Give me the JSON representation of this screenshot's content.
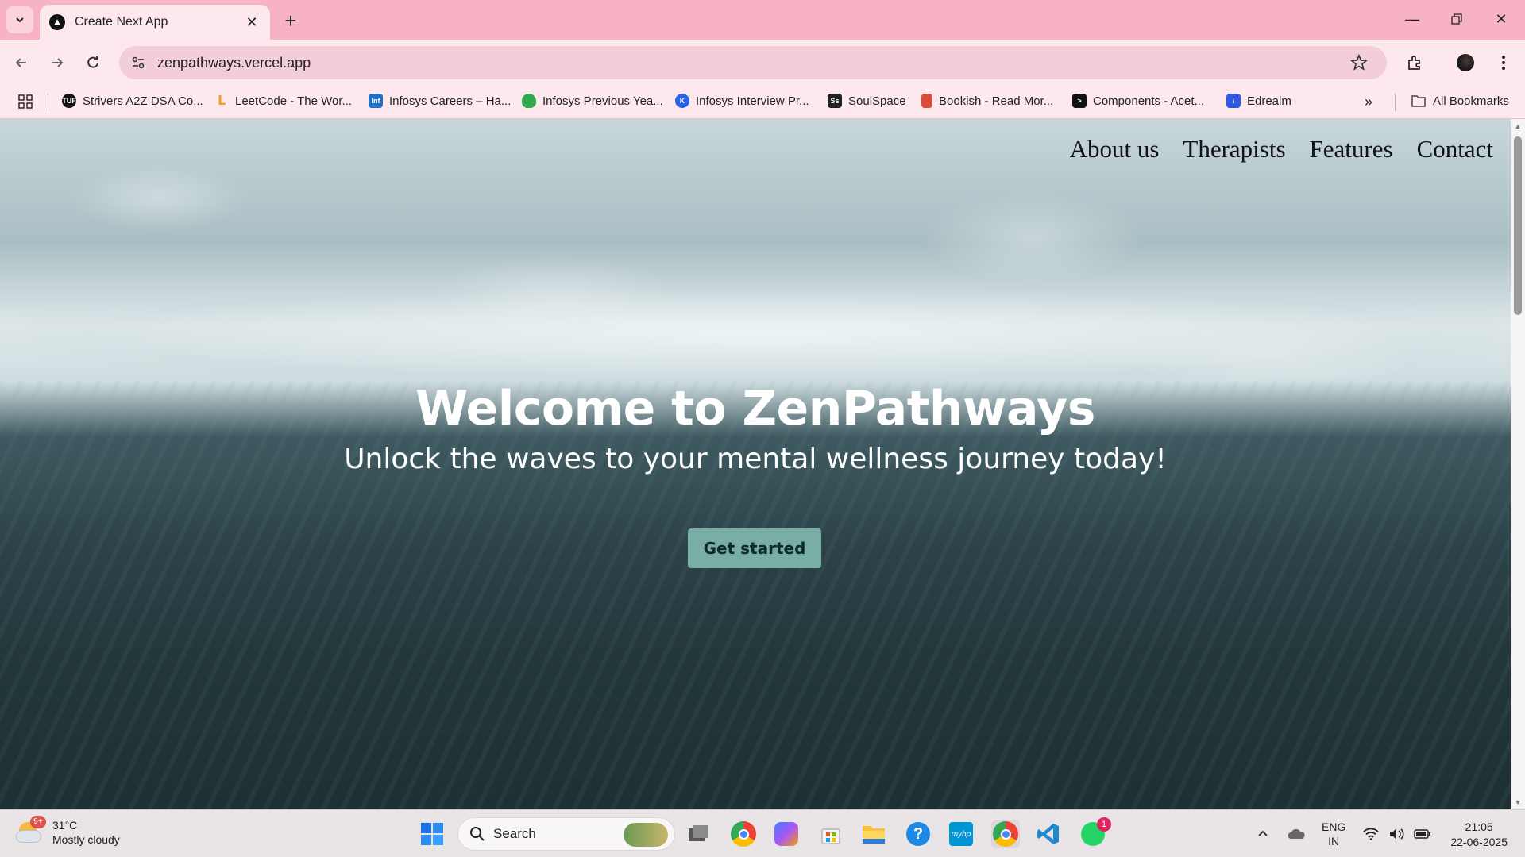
{
  "browser": {
    "tab_title": "Create Next App",
    "url": "zenpathways.vercel.app",
    "bookmarks": [
      {
        "label": "Strivers A2Z DSA Co...",
        "icon": "tuf-icon",
        "color": "#111111"
      },
      {
        "label": "LeetCode - The Wor...",
        "icon": "leetcode-icon",
        "color": "#f89f1b"
      },
      {
        "label": "Infosys Careers – Ha...",
        "icon": "infosys-icon",
        "color": "#1f6fc5"
      },
      {
        "label": "Infosys Previous Yea...",
        "icon": "shield-icon",
        "color": "#2fa84f"
      },
      {
        "label": "Infosys Interview Pr...",
        "icon": "k-icon",
        "color": "#2563eb"
      },
      {
        "label": "SoulSpace",
        "icon": "ss-icon",
        "color": "#222222"
      },
      {
        "label": "Bookish - Read Mor...",
        "icon": "bookmark-icon",
        "color": "#d94b3b"
      },
      {
        "label": "Components - Acet...",
        "icon": "aceternity-icon",
        "color": "#111111"
      },
      {
        "label": "Edrealm",
        "icon": "edrealm-icon",
        "color": "#2f5be0"
      }
    ],
    "all_bookmarks_label": "All Bookmarks"
  },
  "site": {
    "nav": [
      "About us",
      "Therapists",
      "Features",
      "Contact"
    ],
    "hero_title": "Welcome to ZenPathways",
    "hero_subtitle": "Unlock the waves to your mental wellness journey today!",
    "cta_label": "Get started"
  },
  "taskbar": {
    "weather_temp": "31°C",
    "weather_desc": "Mostly cloudy",
    "weather_badge": "9+",
    "search_label": "Search",
    "whatsapp_badge": "1",
    "lang_line1": "ENG",
    "lang_line2": "IN",
    "time": "21:05",
    "date": "22-06-2025"
  },
  "colors": {
    "tabstrip": "#f7b3c3",
    "toolbar": "#fde8ee",
    "cta": "#78aea4",
    "ocean_deep": "#1f3236"
  }
}
